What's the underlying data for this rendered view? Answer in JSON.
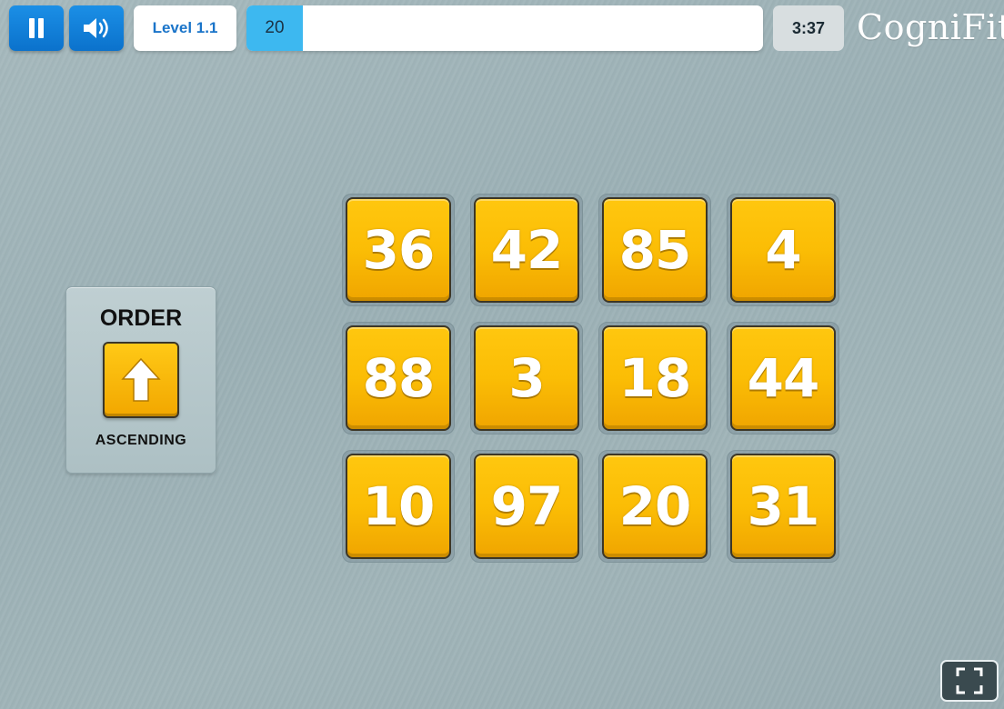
{
  "header": {
    "pause_icon": "pause-icon",
    "sound_icon": "speaker-volume-icon",
    "level_label": "Level 1.1",
    "progress_value": "20",
    "progress_fraction": 0.11,
    "timer": "3:37",
    "logo_text": "CogniFit"
  },
  "order_panel": {
    "title": "ORDER",
    "direction_icon": "arrow-up-icon",
    "direction_label": "ASCENDING"
  },
  "tiles": [
    "36",
    "42",
    "85",
    "4",
    "88",
    "3",
    "18",
    "44",
    "10",
    "97",
    "20",
    "31"
  ],
  "footer": {
    "fullscreen_icon": "fullscreen-icon"
  },
  "colors": {
    "primary_blue": "#0b72cc",
    "progress_fill": "#3db8f0",
    "tile_yellow": "#fbbd05",
    "background": "#a0b4b8"
  }
}
